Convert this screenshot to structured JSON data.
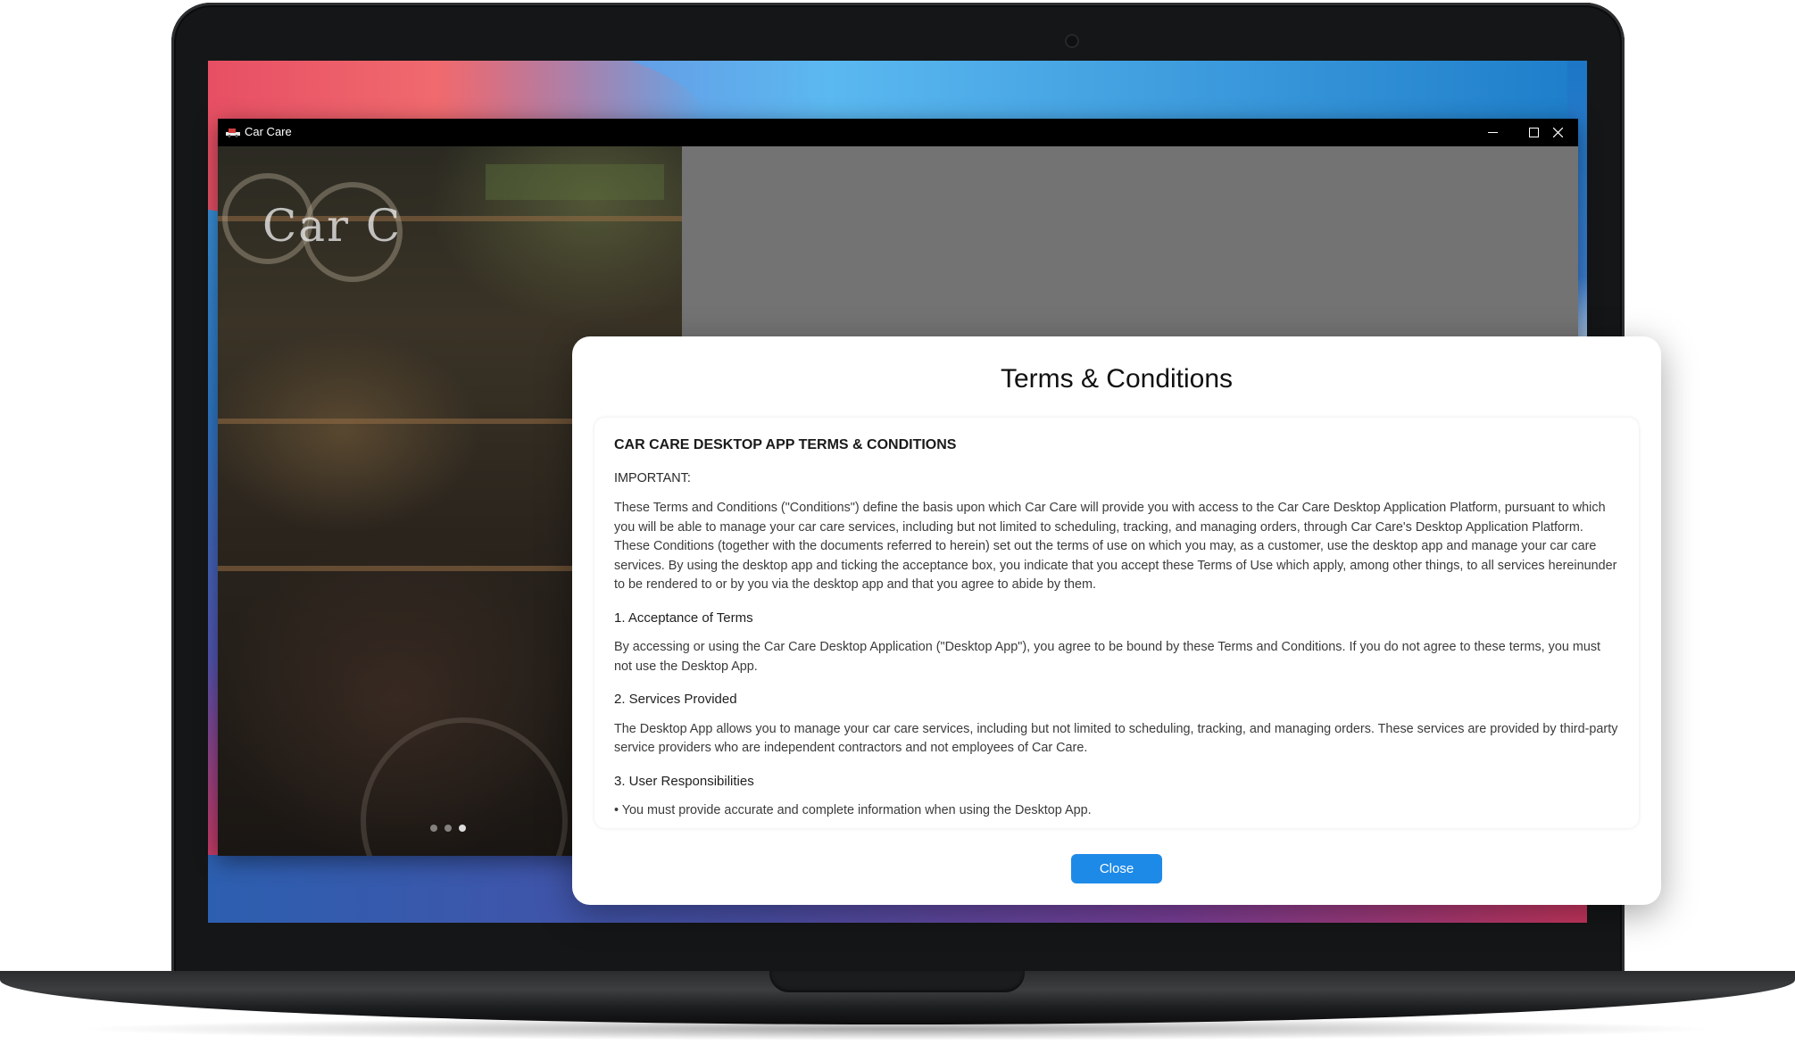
{
  "window": {
    "title": "Car Care"
  },
  "hero": {
    "logo_text": "Car C",
    "carousel_dots": 3,
    "active_dot": 2
  },
  "modal": {
    "title": "Terms & Conditions",
    "heading": "CAR CARE DESKTOP APP TERMS & CONDITIONS",
    "important_label": "IMPORTANT:",
    "intro": "These Terms and Conditions (\"Conditions\") define the basis upon which Car Care will provide you with access to the Car Care Desktop Application Platform, pursuant to which you will be able to manage your car care services, including but not limited to scheduling, tracking, and managing orders, through Car Care's Desktop Application Platform. These Conditions (together with the documents referred to herein) set out the terms of use on which you may, as a customer, use the desktop app and manage your car care services. By using the desktop app and ticking the acceptance box, you indicate that you accept these Terms of Use which apply, among other things, to all services hereinunder to be rendered to or by you via the desktop app and that you agree to abide by them.",
    "sections": [
      {
        "title": "1. Acceptance of Terms",
        "body": "By accessing or using the Car Care Desktop Application (\"Desktop App\"), you agree to be bound by these Terms and Conditions. If you do not agree to these terms, you must not use the Desktop App."
      },
      {
        "title": "2. Services Provided",
        "body": "The Desktop App allows you to manage your car care services, including but not limited to scheduling, tracking, and managing orders. These services are provided by third-party service providers who are independent contractors and not employees of Car Care."
      },
      {
        "title": "3. User Responsibilities",
        "body": "• You must provide accurate and complete information when using the Desktop App."
      }
    ],
    "close_label": "Close"
  },
  "colors": {
    "accent": "#1e8ae8",
    "titlebar": "#000000",
    "overlay": "#737373"
  },
  "icons": {
    "minimize": "minimize-icon",
    "maximize": "maximize-icon",
    "close": "close-icon",
    "app": "app-logo-icon"
  }
}
